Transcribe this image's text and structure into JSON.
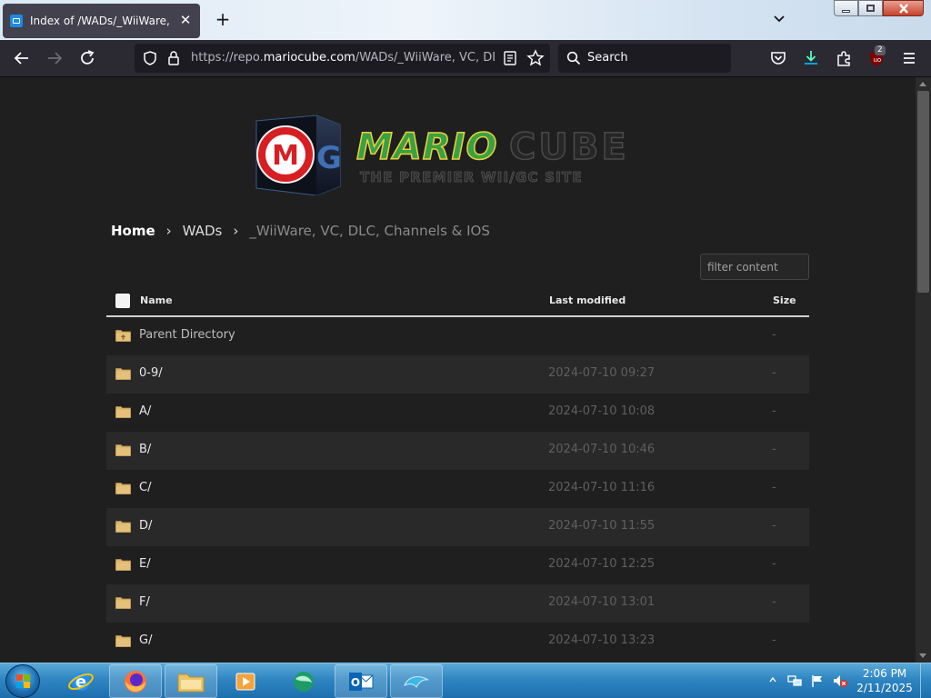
{
  "browser": {
    "tab_title": "Index of /WADs/_WiiWare, VC, DLC, Channels & IOS",
    "tab_close": "✕",
    "new_tab": "+",
    "url_prefix": "https://repo.",
    "url_domain": "mariocube.com",
    "url_path": "/WADs/_WiiWare, VC, DLC, Channels & IOS/",
    "search_placeholder": "Search",
    "extensions_badge": "2"
  },
  "logo": {
    "word_left": "MARIO",
    "word_right": "CUBE",
    "tagline": "THE PREMIER WII/GC SITE",
    "badge_letter": "M",
    "badge_letter2": "G"
  },
  "breadcrumb": {
    "home": "Home",
    "sep": "›",
    "wads": "WADs",
    "current": "_WiiWare, VC, DLC, Channels & IOS"
  },
  "filter": {
    "placeholder": "filter content"
  },
  "listing": {
    "headers": {
      "name": "Name",
      "modified": "Last modified",
      "size": "Size"
    },
    "rows": [
      {
        "name": "Parent Directory",
        "date": "",
        "size": "-"
      },
      {
        "name": "0-9/",
        "date": "2024-07-10 09:27",
        "size": "-"
      },
      {
        "name": "A/",
        "date": "2024-07-10 10:08",
        "size": "-"
      },
      {
        "name": "B/",
        "date": "2024-07-10 10:46",
        "size": "-"
      },
      {
        "name": "C/",
        "date": "2024-07-10 11:16",
        "size": "-"
      },
      {
        "name": "D/",
        "date": "2024-07-10 11:55",
        "size": "-"
      },
      {
        "name": "E/",
        "date": "2024-07-10 12:25",
        "size": "-"
      },
      {
        "name": "F/",
        "date": "2024-07-10 13:01",
        "size": "-"
      },
      {
        "name": "G/",
        "date": "2024-07-10 13:23",
        "size": "-"
      }
    ]
  },
  "taskbar": {
    "time": "2:06 PM",
    "date": "2/11/2025",
    "apps": [
      "internet-explorer",
      "firefox",
      "file-explorer",
      "media-player",
      "marble-app",
      "outlook",
      "dolphin-emulator"
    ]
  },
  "colors": {
    "page_bg": "#1f1f1f",
    "row_alt": "#292929",
    "toolbar": "#2b2a33",
    "folder": "#d9b46c",
    "taskbar": "#2f86c2"
  }
}
